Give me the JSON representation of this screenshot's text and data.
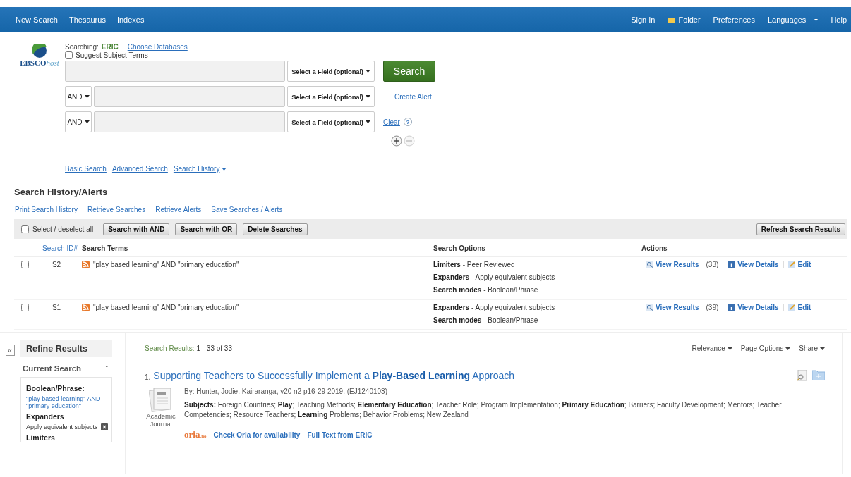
{
  "nav": {
    "left": [
      {
        "label": "New Search",
        "kind": "link"
      },
      {
        "label": "Thesaurus",
        "kind": "link"
      },
      {
        "label": "Indexes",
        "kind": "link"
      }
    ],
    "right": [
      {
        "label": "Sign In",
        "kind": "link"
      },
      {
        "label": "Folder",
        "kind": "folder"
      },
      {
        "label": "Preferences",
        "kind": "link"
      },
      {
        "label": "Languages",
        "kind": "menu"
      },
      {
        "label": "Help",
        "kind": "link"
      }
    ]
  },
  "logo": {
    "brand": "EBSCO",
    "suffix": "host"
  },
  "search": {
    "searching_label": "Searching:",
    "database": "ERIC",
    "choose_link": "Choose Databases",
    "suggest": {
      "label": "Suggest Subject Terms",
      "checked": false
    },
    "rows": [
      {
        "field": "Select a Field (optional)"
      },
      {
        "operator": "AND",
        "field": "Select a Field (optional)"
      },
      {
        "operator": "AND",
        "field": "Select a Field (optional)"
      }
    ],
    "search_button": "Search",
    "create_alert": "Create Alert",
    "clear": "Clear",
    "help": "?",
    "links": [
      {
        "label": "Basic Search",
        "kind": "link"
      },
      {
        "label": "Advanced Search",
        "kind": "link"
      },
      {
        "label": "Search History",
        "kind": "menu"
      }
    ]
  },
  "history": {
    "title": "Search History/Alerts",
    "links": [
      "Print Search History",
      "Retrieve Searches",
      "Retrieve Alerts",
      "Save Searches / Alerts"
    ],
    "select_all": {
      "label": "Select / deselect all",
      "checked": false
    },
    "buttons": [
      "Search with AND",
      "Search with OR",
      "Delete Searches"
    ],
    "refresh": "Refresh Search Results",
    "columns": [
      "Search ID#",
      "Search Terms",
      "Search Options",
      "Actions"
    ],
    "rows": [
      {
        "checked": false,
        "id": "S2",
        "terms": "\"play based learning\" AND \"primary education\"",
        "options": [
          {
            "label": "Limiters",
            "value": "- Peer Reviewed"
          },
          {
            "label": "Expanders",
            "value": "- Apply equivalent subjects"
          },
          {
            "label": "Search modes",
            "value": "- Boolean/Phrase"
          }
        ],
        "view_results": "View Results",
        "count": "(33)",
        "details": "View Details",
        "edit": "Edit"
      },
      {
        "checked": false,
        "id": "S1",
        "terms": "\"play based learning\" AND \"primary education\"",
        "options": [
          {
            "label": "Expanders",
            "value": "- Apply equivalent subjects"
          },
          {
            "label": "Search modes",
            "value": "- Boolean/Phrase"
          }
        ],
        "view_results": "View Results",
        "count": "(39)",
        "details": "View Details",
        "edit": "Edit"
      }
    ]
  },
  "refine": {
    "collapse": "«",
    "title": "Refine Results",
    "section": "Current Search",
    "caret": "ˇ",
    "boolean_label": "Boolean/Phrase:",
    "boolean_query": "\"play based learning\" AND \"primary education\"",
    "expanders_label": "Expanders",
    "expander": "Apply equivalent subjects",
    "limiters_label": "Limiters"
  },
  "results": {
    "summary_label": "Search Results:",
    "summary": "1 - 33 of 33",
    "menus": [
      "Relevance",
      "Page Options",
      "Share"
    ],
    "items": [
      {
        "number": "1.",
        "title": "Supporting Teachers to Successfully Implement a **Play-Based Learning** Approach",
        "byline": "By: Hunter, Jodie. Kairaranga, v20 n2 p16-29 2019. (EJ1240103)",
        "subjects": "**Subjects:** Foreign Countries; **Play**; Teaching Methods; **Elementary Education**; Teacher Role; Program Implementation; **Primary Education**; Barriers; Faculty Development; Mentors; Teacher Competencies; Resource Teachers; **Learning** Problems; Behavior Problems; New Zealand",
        "type": "Academic Journal",
        "oria": "oria",
        "oria_suffix": ".no",
        "links": [
          "Check Oria for availability",
          "Full Text from ERIC"
        ]
      }
    ]
  }
}
